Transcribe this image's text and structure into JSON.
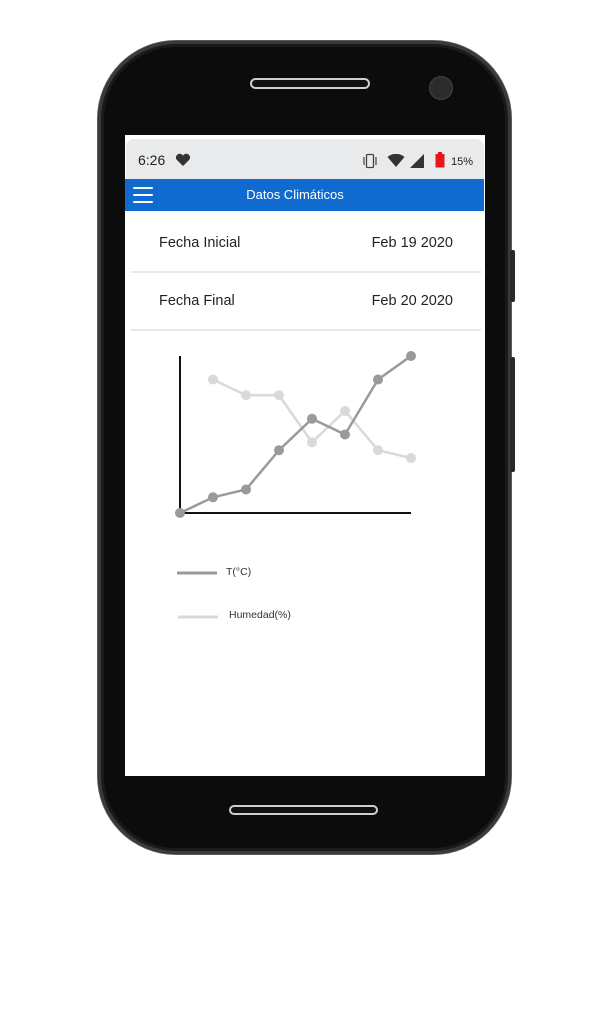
{
  "status_bar": {
    "time": "6:26",
    "battery_percent": "15%",
    "icons": [
      "heart-icon",
      "vibrate-icon",
      "wifi-icon",
      "signal-icon",
      "battery-icon"
    ],
    "battery_color": "#e8161b"
  },
  "app_bar": {
    "title": "Datos Climáticos",
    "color": "#0f6bd0"
  },
  "dates": {
    "start_label": "Fecha Inicial",
    "start_value": "Feb 19 2020",
    "end_label": "Fecha Final",
    "end_value": "Feb 20 2020"
  },
  "chart_data": {
    "type": "line",
    "x": [
      1,
      2,
      3,
      4,
      5,
      6,
      7,
      8
    ],
    "ylim": [
      0,
      100
    ],
    "grid": false,
    "legend": "below",
    "series": [
      {
        "name": "T(°C)",
        "color": "#9a9a9a",
        "x": [
          1,
          2,
          3,
          4,
          5,
          6,
          7,
          8
        ],
        "values": [
          0,
          10,
          15,
          40,
          60,
          50,
          85,
          100
        ]
      },
      {
        "name": "Humedad(%)",
        "color": "#d9d9d9",
        "x": [
          2,
          3,
          4,
          5,
          6,
          7,
          8
        ],
        "values": [
          85,
          75,
          75,
          45,
          65,
          40,
          35
        ]
      }
    ]
  }
}
